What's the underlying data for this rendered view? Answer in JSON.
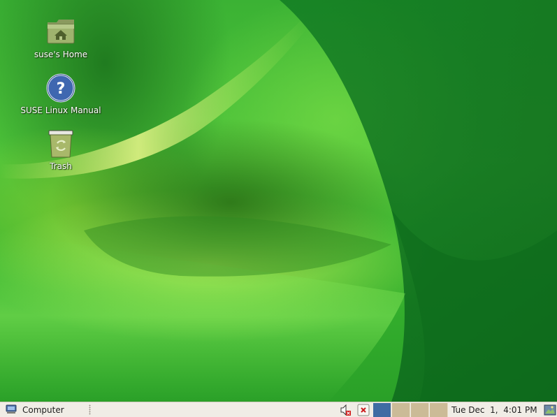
{
  "desktop": {
    "icons": [
      {
        "label": "suse's Home",
        "icon": "home-folder-icon"
      },
      {
        "label": "SUSE Linux Manual",
        "icon": "help-icon"
      },
      {
        "label": "Trash",
        "icon": "trash-icon"
      }
    ]
  },
  "panel": {
    "menu_label": "Computer",
    "menu_icon": "computer-icon",
    "tray": [
      "volume-muted-icon",
      "network-disconnected-icon"
    ],
    "workspaces": {
      "count": 4,
      "active": 1
    },
    "clock": "Tue Dec  1,  4:01 PM",
    "show_desktop_icon": "show-desktop-icon"
  },
  "colors": {
    "panel_bg": "#f0ede6",
    "workspace_active": "#3f6ca3",
    "workspace_inactive": "#cbbb97"
  }
}
